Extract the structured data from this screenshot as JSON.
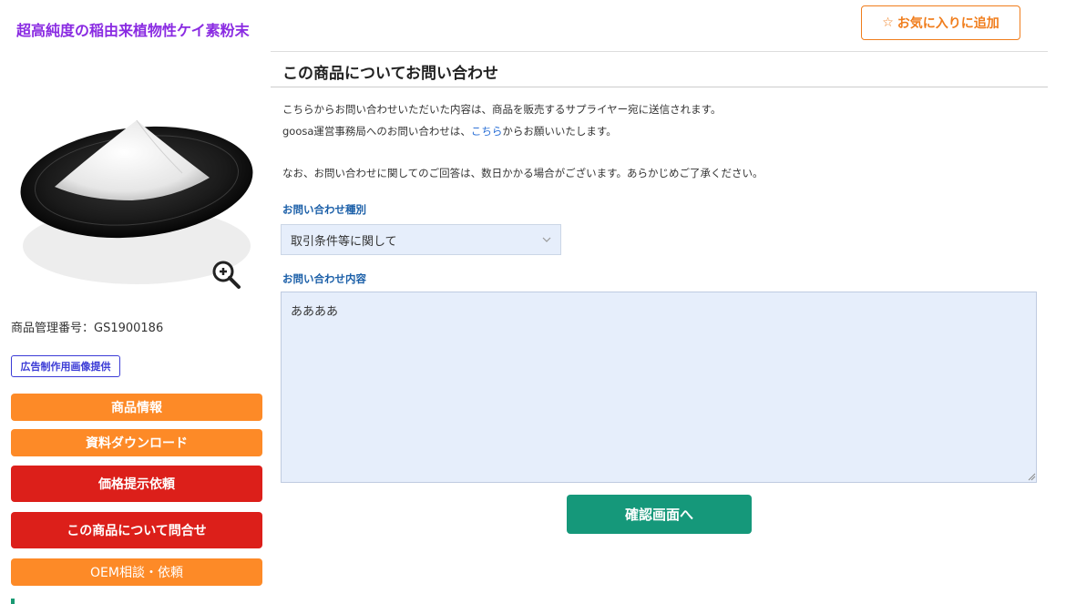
{
  "header": {
    "product_title": "超高純度の稲由来植物性ケイ素粉末",
    "favorite_label": "お気に入りに追加",
    "favorite_icon": "star-outline-icon",
    "favorite_glyph": "☆"
  },
  "sidebar": {
    "product_code_label": "商品管理番号：GS1900186",
    "ad_image_badge": "広告制作用画像提供",
    "buttons": [
      {
        "label": "商品情報",
        "color": "orange"
      },
      {
        "label": "資料ダウンロード",
        "color": "orange"
      },
      {
        "label": "価格提示依頼",
        "color": "red"
      },
      {
        "label": "この商品について問合せ",
        "color": "red"
      },
      {
        "label": "OEM相談・依頼",
        "color": "orange"
      }
    ]
  },
  "main": {
    "heading": "この商品についてお問い合わせ",
    "notice_line1": "こちらからお問い合わせいただいた内容は、商品を販売するサプライヤー宛に送信されます。",
    "notice_line2_prefix": "goosa運営事務局へのお問い合わせは、",
    "notice_line2_link": "こちら",
    "notice_line2_suffix": "からお願いいたします。",
    "notice_line3": "なお、お問い合わせに関してのご回答は、数日かかる場合がございます。あらかじめご了承ください。",
    "type_label": "お問い合わせ種別",
    "type_selected": "取引条件等に関して",
    "content_label": "お問い合わせ内容",
    "content_value": "ああああ",
    "confirm_label": "確認画面へ"
  },
  "colors": {
    "title_purple": "#8a2be2",
    "orange": "#fd8a27",
    "red": "#dc1f1a",
    "green": "#15987a",
    "label_blue": "#1b5fa8",
    "field_bg": "#e6eefb"
  }
}
